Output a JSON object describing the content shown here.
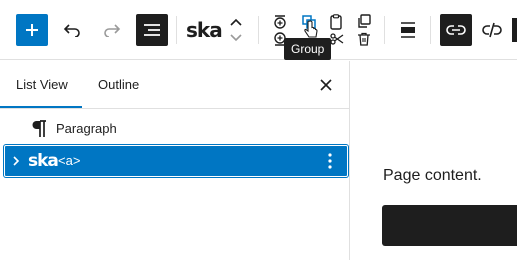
{
  "toolbar": {
    "brand_text": "ska",
    "tooltip_text": "Group",
    "buttons": [
      "add-block",
      "undo",
      "redo",
      "list-view",
      "move-up",
      "move-down",
      "insert-before",
      "group",
      "duplicate",
      "copy",
      "insert-after",
      "cut",
      "delete",
      "align",
      "link",
      "unlink"
    ]
  },
  "sidebar": {
    "tabs": [
      {
        "label": "List View",
        "active": true
      },
      {
        "label": "Outline",
        "active": false
      }
    ],
    "items": [
      {
        "icon": "paragraph-icon",
        "label": "Paragraph",
        "selected": false
      },
      {
        "icon": "ska-block-icon",
        "icon_text": "ska",
        "label": "<a>",
        "selected": true
      }
    ]
  },
  "canvas": {
    "text": "Page content."
  },
  "colors": {
    "accent": "#0076c3",
    "dark": "#1e1e1e",
    "border": "#e0e0e0"
  }
}
